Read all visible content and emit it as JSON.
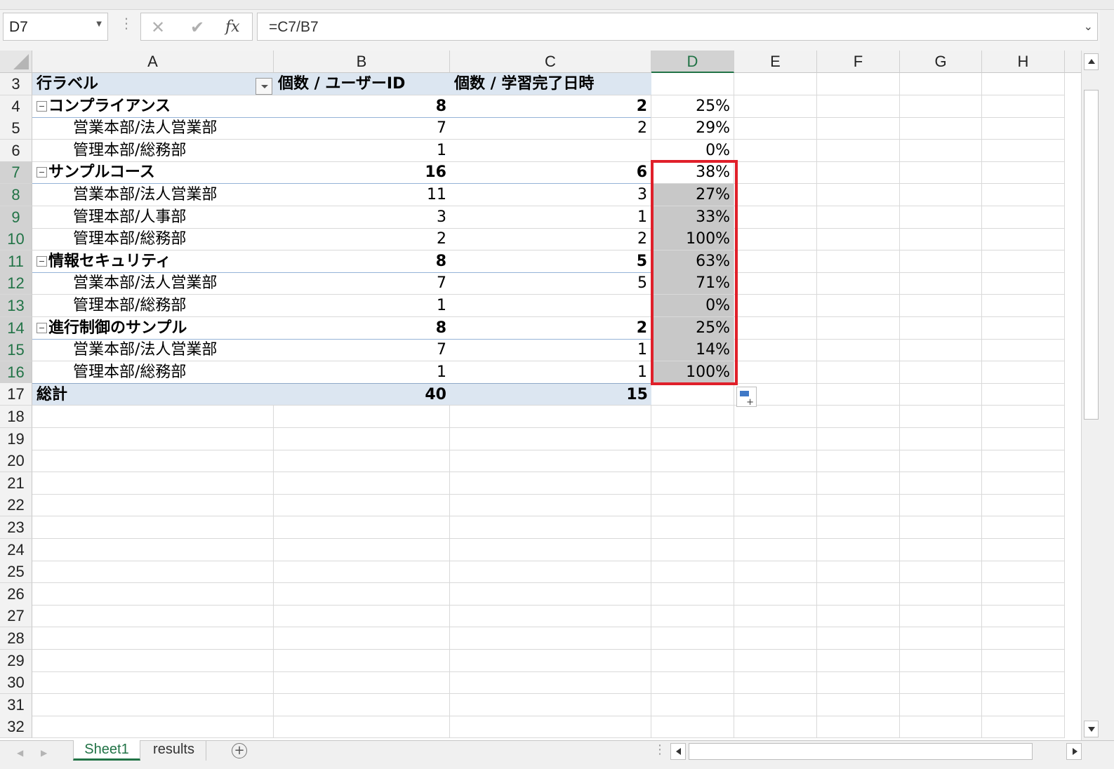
{
  "name_box": "D7",
  "formula": "=C7/B7",
  "fx_label": "fx",
  "columns": [
    "A",
    "B",
    "C",
    "D",
    "E",
    "F",
    "G",
    "H"
  ],
  "selected_column": "D",
  "pivot": {
    "header": {
      "row": "3",
      "a": "行ラベル",
      "b": "個数 / ユーザーID",
      "c": "個数 / 学習完了日時"
    },
    "rows": [
      {
        "row": "4",
        "level": 0,
        "a": "コンプライアンス",
        "b": "8",
        "c": "2",
        "d": "25%"
      },
      {
        "row": "5",
        "level": 1,
        "a": "営業本部/法人営業部",
        "b": "7",
        "c": "2",
        "d": "29%"
      },
      {
        "row": "6",
        "level": 1,
        "a": "管理本部/総務部",
        "b": "1",
        "c": "",
        "d": "0%"
      },
      {
        "row": "7",
        "level": 0,
        "a": "サンプルコース",
        "b": "16",
        "c": "6",
        "d": "38%"
      },
      {
        "row": "8",
        "level": 1,
        "a": "営業本部/法人営業部",
        "b": "11",
        "c": "3",
        "d": "27%"
      },
      {
        "row": "9",
        "level": 1,
        "a": "管理本部/人事部",
        "b": "3",
        "c": "1",
        "d": "33%"
      },
      {
        "row": "10",
        "level": 1,
        "a": "管理本部/総務部",
        "b": "2",
        "c": "2",
        "d": "100%"
      },
      {
        "row": "11",
        "level": 0,
        "a": "情報セキュリティ",
        "b": "8",
        "c": "5",
        "d": "63%"
      },
      {
        "row": "12",
        "level": 1,
        "a": "営業本部/法人営業部",
        "b": "7",
        "c": "5",
        "d": "71%"
      },
      {
        "row": "13",
        "level": 1,
        "a": "管理本部/総務部",
        "b": "1",
        "c": "",
        "d": "0%"
      },
      {
        "row": "14",
        "level": 0,
        "a": "進行制御のサンプル",
        "b": "8",
        "c": "2",
        "d": "25%"
      },
      {
        "row": "15",
        "level": 1,
        "a": "営業本部/法人営業部",
        "b": "7",
        "c": "1",
        "d": "14%"
      },
      {
        "row": "16",
        "level": 1,
        "a": "管理本部/総務部",
        "b": "1",
        "c": "1",
        "d": "100%"
      }
    ],
    "total": {
      "row": "17",
      "a": "総計",
      "b": "40",
      "c": "15"
    }
  },
  "empty_rows": [
    "18",
    "19",
    "20",
    "21",
    "22",
    "23",
    "24",
    "25",
    "26",
    "27",
    "28",
    "29",
    "30",
    "31",
    "32"
  ],
  "selected_rows": [
    "7",
    "8",
    "9",
    "10",
    "11",
    "12",
    "13",
    "14",
    "15",
    "16"
  ],
  "sheet_tabs": [
    {
      "label": "Sheet1",
      "active": true
    },
    {
      "label": "results",
      "active": false
    }
  ],
  "add_sheet": "+",
  "colors": {
    "accent": "#217346",
    "pivot_header": "#dce6f1",
    "selection_highlight": "#e0202a",
    "selected_fill": "#c8c8c8"
  }
}
